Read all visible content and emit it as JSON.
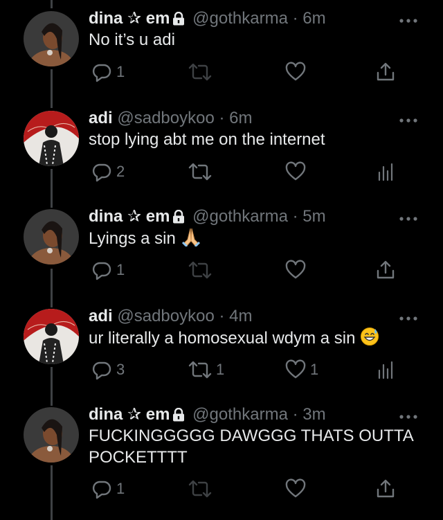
{
  "tweets": [
    {
      "author": "dina",
      "star": "✰",
      "author2": "em",
      "locked": true,
      "handle": "@gothkarma",
      "sep": "·",
      "time": "6m",
      "text": "No it’s u adi",
      "replies": "1",
      "retweets": "",
      "likes": "",
      "share": "share-icon"
    },
    {
      "author": "adi",
      "star": "",
      "author2": "",
      "locked": false,
      "handle": "@sadboykoo",
      "sep": "·",
      "time": "6m",
      "text": "stop lying abt me on the internet",
      "replies": "2",
      "retweets": "",
      "likes": "",
      "share": "analytics-icon"
    },
    {
      "author": "dina",
      "star": "✰",
      "author2": "em",
      "locked": true,
      "handle": "@gothkarma",
      "sep": "·",
      "time": "5m",
      "text": "Lyings a sin",
      "emoji": "folded-hands-emoji",
      "replies": "1",
      "retweets": "",
      "likes": "",
      "share": "share-icon"
    },
    {
      "author": "adi",
      "star": "",
      "author2": "",
      "locked": false,
      "handle": "@sadboykoo",
      "sep": "·",
      "time": "4m",
      "text": "ur literally a homosexual wdym a sin",
      "emoji": "grinning-sweat-emoji",
      "replies": "3",
      "retweets": "1",
      "likes": "1",
      "share": "analytics-icon"
    },
    {
      "author": "dina",
      "star": "✰",
      "author2": "em",
      "locked": true,
      "handle": "@gothkarma",
      "sep": "·",
      "time": "3m",
      "text": "FUCKINGGGGG DAWGGG THATS OUTTA POCKETTTT",
      "replies": "1",
      "retweets": "",
      "likes": "",
      "share": "share-icon"
    }
  ],
  "colors": {
    "background": "#000000",
    "text": "#e7e9ea",
    "muted": "#71767b",
    "thread_line": "#3e4144"
  }
}
